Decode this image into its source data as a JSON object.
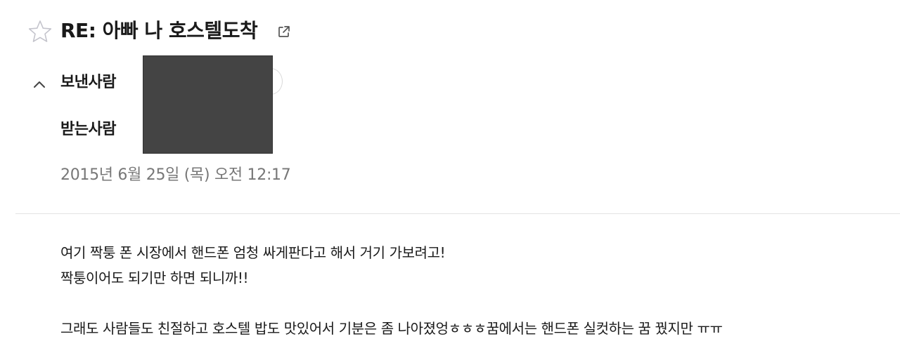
{
  "email": {
    "subject": "RE: 아빠 나 호스텔도착",
    "sender_label": "보낸사람",
    "recipient_label": "받는사람",
    "date": "2015년 6월 25일 (목) 오전 12:17",
    "body_lines": [
      "여기 짝퉁 폰 시장에서 핸드폰 엄청 싸게판다고 해서 거기 가보려고!",
      "짝퉁이어도 되기만 하면 되니까!!",
      "",
      "그래도 사람들도 친절하고 호스텔 밥도 맛있어서 기분은 좀 나아졌엉ㅎㅎㅎ꿈에서는 핸드폰 실컷하는 꿈 꿨지만 ㅠㅠ"
    ]
  },
  "icons": {
    "star": "star-icon",
    "popout": "external-link-icon",
    "collapse": "chevron-up-icon"
  },
  "colors": {
    "redaction": "#444444",
    "date_text": "#777777",
    "divider": "#e3e3e3"
  }
}
